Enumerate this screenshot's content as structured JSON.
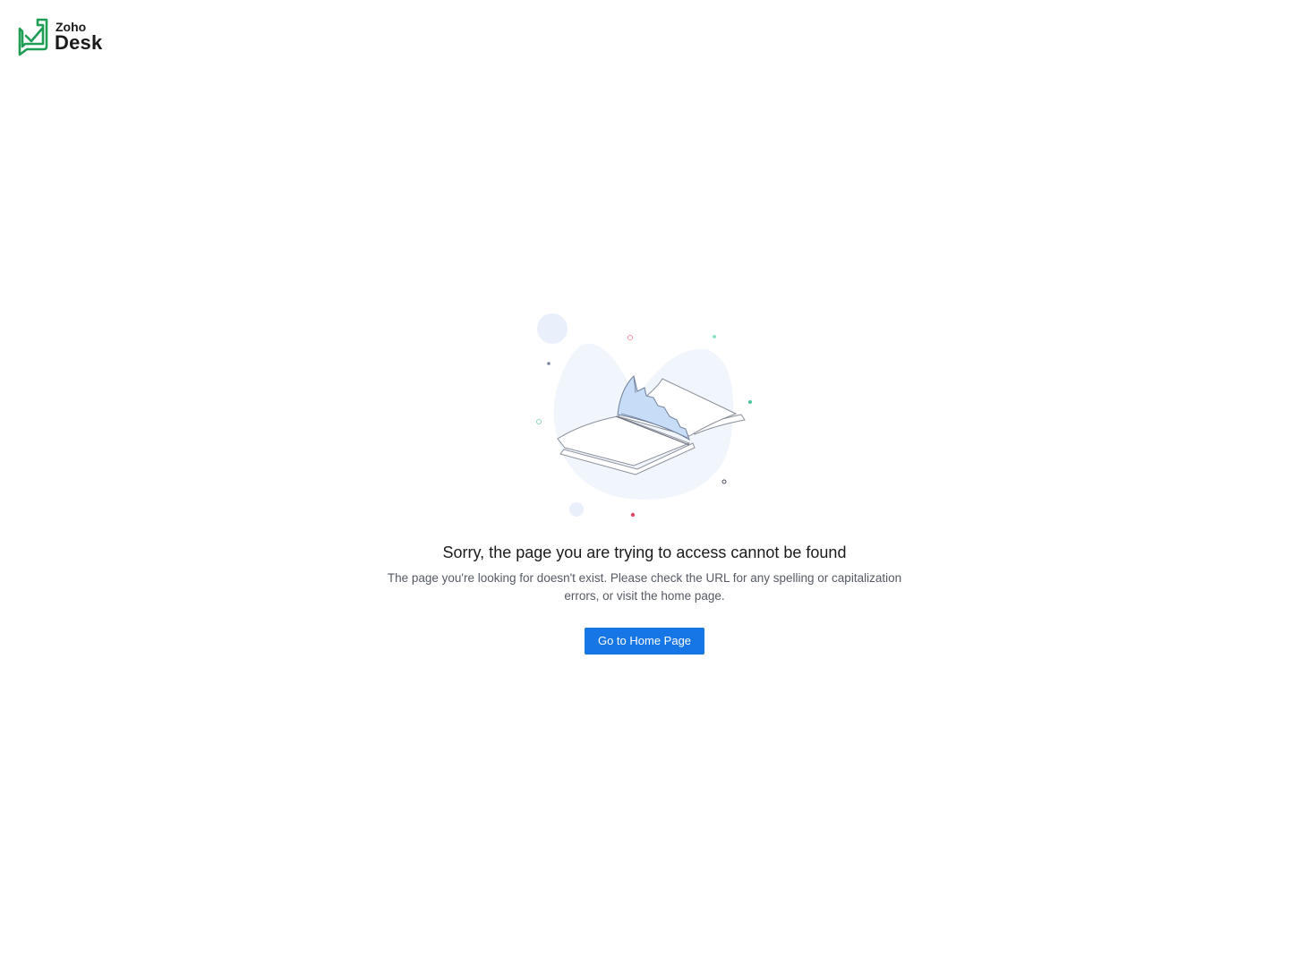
{
  "brand": {
    "logo_top_text": "Zoho",
    "logo_main_text": "Desk",
    "logo_color": "#1f9d55"
  },
  "illustration": {
    "icon": "torn-book-icon"
  },
  "error": {
    "title": "Sorry, the page you are trying to access cannot be found",
    "description": "The page you're looking for doesn't exist. Please check the URL for any spelling or capitalization errors, or visit the home page."
  },
  "actions": {
    "home_label": "Go to Home Page",
    "accent": "#1776e6"
  }
}
